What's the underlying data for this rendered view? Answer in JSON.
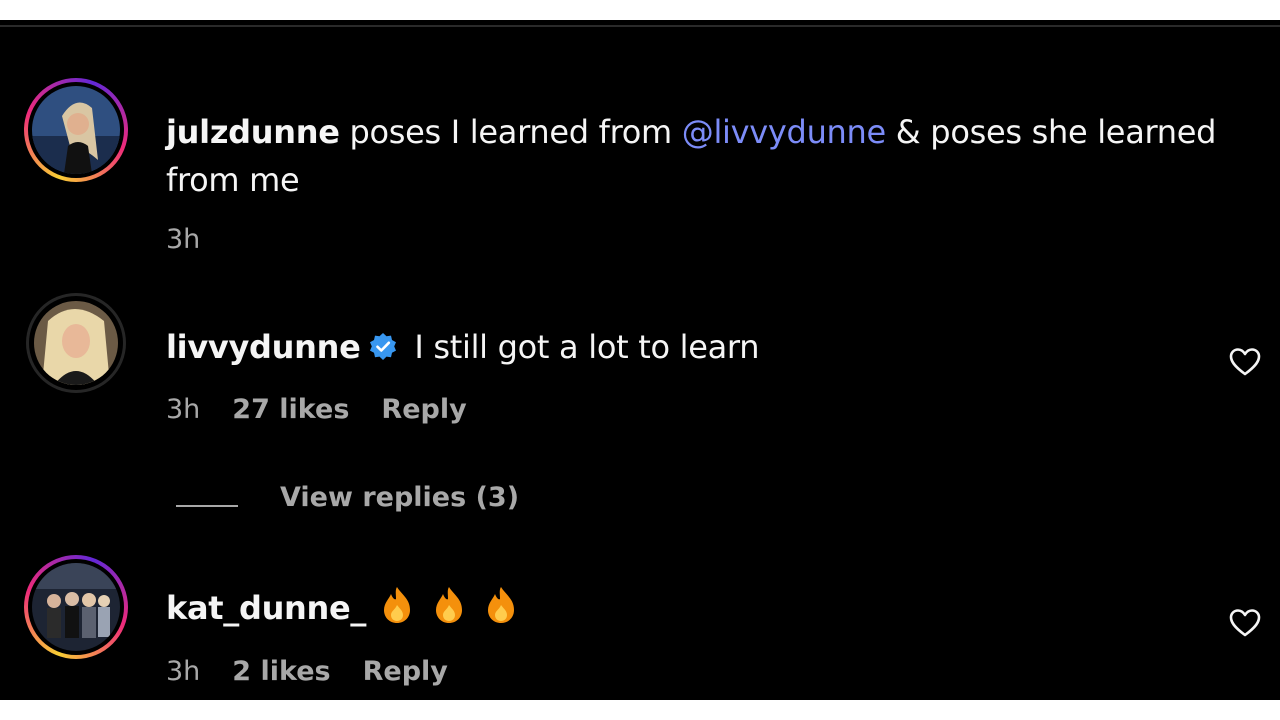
{
  "comments": [
    {
      "username": "julzdunne",
      "text_pre": "poses I learned from ",
      "mention": "@livvydunne",
      "text_post": " & poses she learned",
      "text_line2": "from me",
      "time": "3h",
      "avatar_ring": "story",
      "icon": "avatar"
    },
    {
      "username": "livvydunne",
      "verified": true,
      "text": "I still got a lot to learn",
      "time": "3h",
      "likes": "27 likes",
      "reply": "Reply",
      "avatar_ring": "plain",
      "like_icon": "heart-outline-icon"
    },
    {
      "username": "kat_dunne_",
      "emojis": [
        "fire-emoji",
        "fire-emoji",
        "fire-emoji"
      ],
      "time": "3h",
      "likes": "2 likes",
      "reply": "Reply",
      "avatar_ring": "story",
      "like_icon": "heart-outline-icon"
    }
  ],
  "view_replies": "View replies (3)",
  "colors": {
    "background": "#000000",
    "text": "#f5f5f5",
    "muted": "#a8a8a8",
    "mention": "#7c8cf8",
    "verified": "#3897f0",
    "fire": "#f4900c"
  }
}
